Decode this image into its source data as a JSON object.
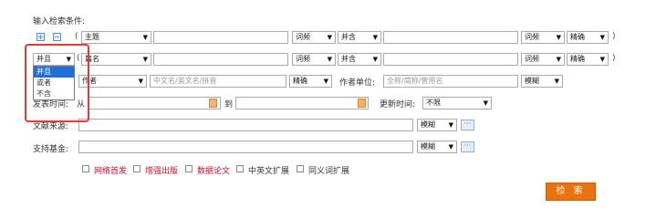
{
  "form": {
    "title": "输入检索条件:",
    "add_icon": "+",
    "remove_icon": "−",
    "search_button": "检 索"
  },
  "row1": {
    "paren_open": "(",
    "field": "主题",
    "match1": "词频",
    "logic": "并含",
    "match2": "词频",
    "precision": "精确",
    "paren_close": ")"
  },
  "row2": {
    "bool": "并且",
    "paren_open": "(",
    "field": "篇名",
    "match1": "词频",
    "logic": "并含",
    "match2": "词频",
    "precision": "精确",
    "paren_close": ")"
  },
  "bool_options": [
    "并且",
    "或者",
    "不含"
  ],
  "author_row": {
    "field": "作者",
    "name_placeholder": "中文名/英文名/拼音",
    "precision": "精确",
    "unit_label": "作者单位:",
    "unit_placeholder": "全称/简称/曾用名",
    "unit_match": "模糊"
  },
  "date_row": {
    "label": "发表时间:",
    "from": "从",
    "to": "到",
    "update_label": "更新时间:",
    "update_value": "不限"
  },
  "source_row": {
    "label": "文献来源:",
    "match": "模糊",
    "more": "···"
  },
  "fund_row": {
    "label": "支持基金:",
    "match": "模糊",
    "more": "···"
  },
  "checkboxes": [
    {
      "label": "网络首发",
      "red": true
    },
    {
      "label": "增强出版",
      "red": true
    },
    {
      "label": "数据论文",
      "red": true
    },
    {
      "label": "中英文扩展",
      "red": false
    },
    {
      "label": "同义词扩展",
      "red": false
    }
  ],
  "icons": {
    "arrow": "▼"
  }
}
